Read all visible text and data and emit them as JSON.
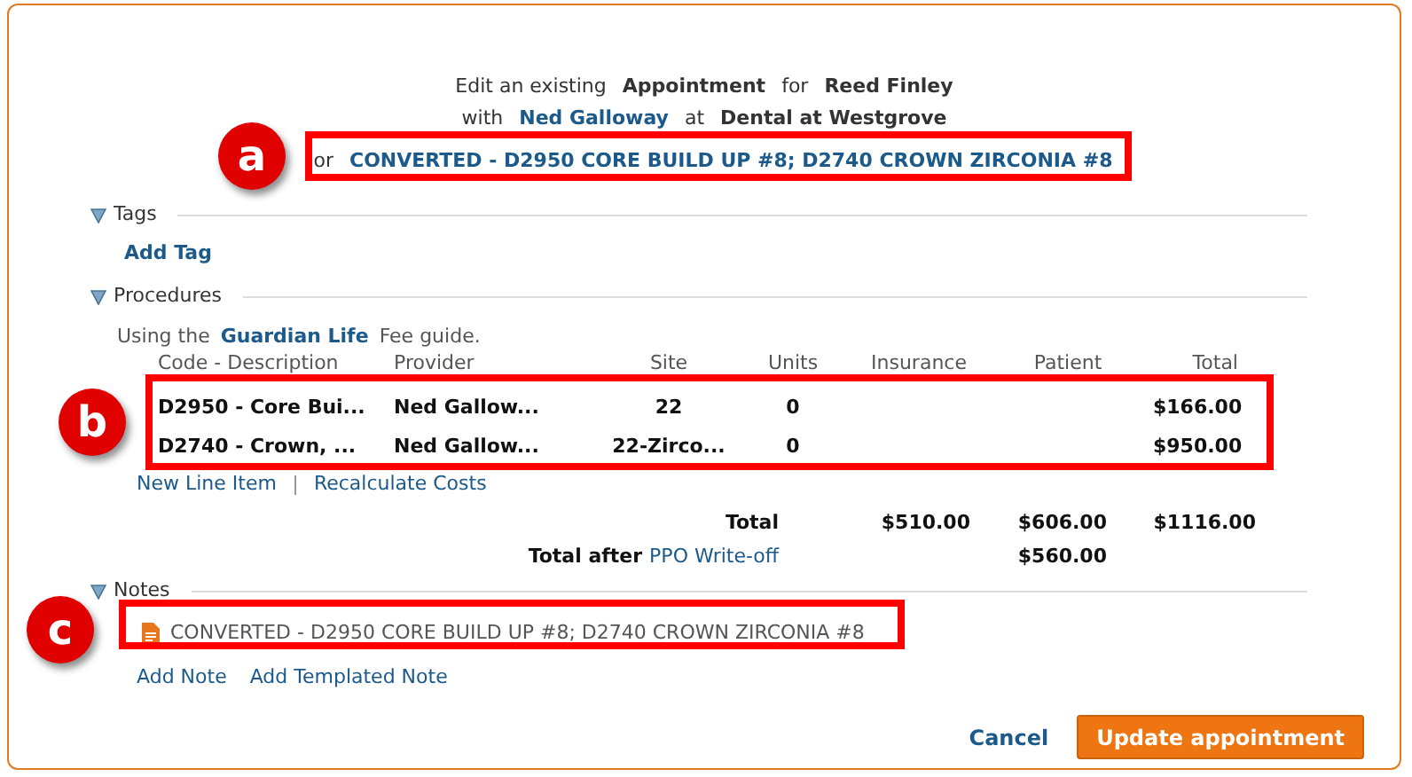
{
  "header": {
    "line1": [
      {
        "text": "Edit an existing",
        "kind": "plain"
      },
      {
        "text": "Appointment",
        "kind": "bold"
      },
      {
        "text": "for",
        "kind": "plain"
      },
      {
        "text": "Reed Finley",
        "kind": "bold"
      }
    ],
    "line2": [
      {
        "text": "with",
        "kind": "plain"
      },
      {
        "text": "Ned Galloway",
        "kind": "link"
      },
      {
        "text": "at",
        "kind": "plain"
      },
      {
        "text": "Dental at Westgrove",
        "kind": "bold"
      }
    ],
    "line3": [
      {
        "text": "or",
        "kind": "plain"
      },
      {
        "text": "CONVERTED - D2950 CORE BUILD UP #8; D2740 CROWN ZIRCONIA #8",
        "kind": "link"
      }
    ]
  },
  "tags": {
    "label": "Tags",
    "expanded": true,
    "links": [
      "Add Tag"
    ]
  },
  "procedures": {
    "label": "Procedures",
    "expanded": true,
    "fee_prefix": "Using the",
    "fee_guide": "Guardian Life",
    "fee_suffix": "Fee guide.",
    "columns": [
      "Code - Description",
      "Provider",
      "Site",
      "Units",
      "Insurance",
      "Patient",
      "Total"
    ],
    "rows": [
      [
        "D2950 - Core Bui...",
        "Ned Gallow...",
        "22",
        "0",
        "",
        "",
        "$166.00"
      ],
      [
        "D2740 - Crown, ...",
        "Ned Gallow...",
        "22-Zirco...",
        "0",
        "",
        "",
        "$950.00"
      ]
    ],
    "links": [
      "New Line Item",
      "Recalculate Costs"
    ],
    "total": {
      "label": "Total",
      "insurance": "$510.00",
      "patient": "$606.00",
      "total": "$1116.00"
    },
    "total_after": {
      "label": "Total after",
      "link": "PPO Write-off",
      "patient": "$560.00"
    }
  },
  "notes": {
    "label": "Notes",
    "expanded": true,
    "items": [
      "CONVERTED - D2950 CORE BUILD UP #8; D2740 CROWN ZIRCONIA #8"
    ],
    "links": [
      "Add Note",
      "Add Templated Note"
    ]
  },
  "buttons": {
    "cancel": "Cancel",
    "submit": "Update appointment"
  },
  "callouts": [
    "a",
    "b",
    "c"
  ]
}
